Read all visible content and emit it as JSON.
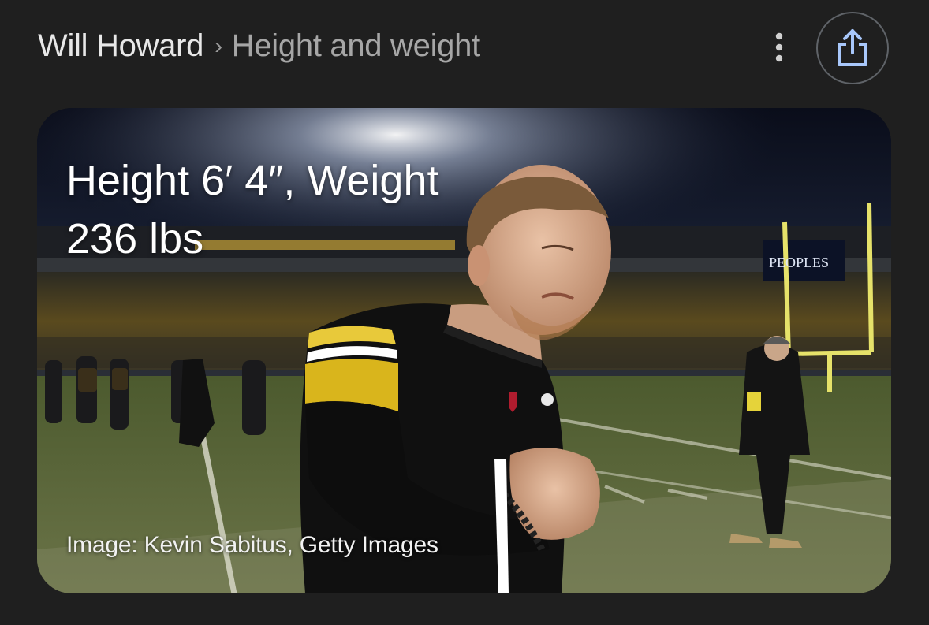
{
  "breadcrumb": {
    "root": "Will Howard",
    "separator": "›",
    "current": "Height and weight"
  },
  "header_actions": {
    "more_icon": "vertical-dots-icon",
    "share_icon": "share-icon"
  },
  "card": {
    "headline_line1": "Height 6′ 4″, Weight",
    "headline_line2": "236 lbs",
    "image_credit": "Image: Kevin Sabitus, Getty Images",
    "scoreboard_sign": "PEOPLES"
  },
  "colors": {
    "background": "#1f1f1f",
    "share_icon": "#a8c7fa",
    "share_ring": "#5f6368",
    "jersey_black": "#101010",
    "jersey_gold": "#d9b51c",
    "goalpost_yellow": "#e6e26a"
  }
}
